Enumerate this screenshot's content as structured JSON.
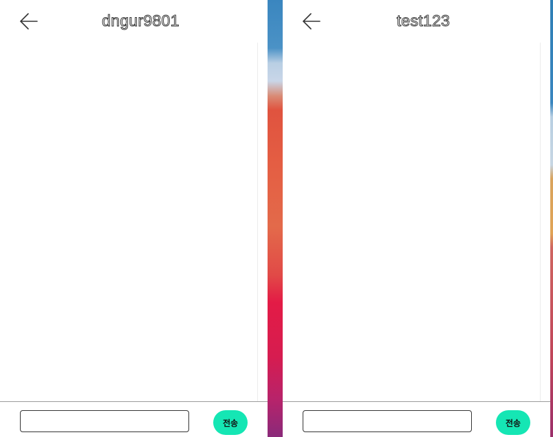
{
  "windows": [
    {
      "title": "dngur9801",
      "input": {
        "value": "",
        "placeholder": ""
      },
      "send_label": "전송"
    },
    {
      "title": "test123",
      "input": {
        "value": "",
        "placeholder": ""
      },
      "send_label": "전송"
    }
  ],
  "icons": {
    "back": "arrow-left-icon"
  },
  "colors": {
    "send_button": "#15e6b4",
    "header_text_stroke": "#333333"
  }
}
